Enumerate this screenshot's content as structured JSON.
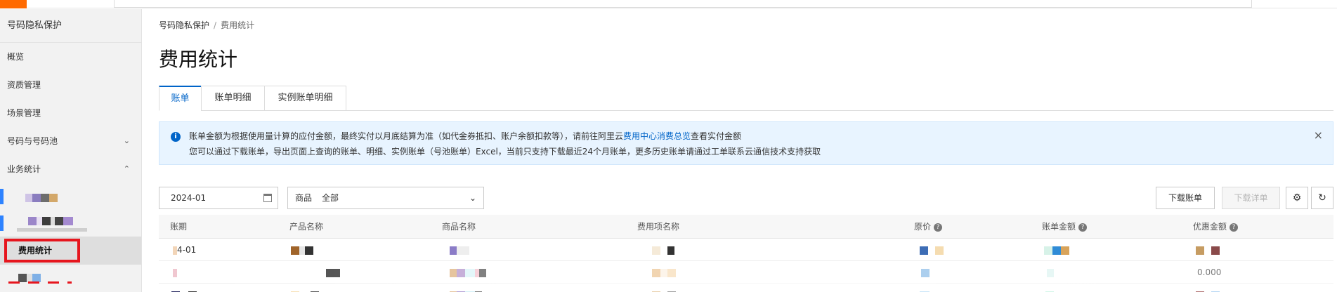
{
  "sidebar": {
    "title": "号码隐私保护",
    "items": [
      {
        "label": "概览"
      },
      {
        "label": "资质管理"
      },
      {
        "label": "场景管理"
      },
      {
        "label": "号码与号码池",
        "chevron": "chevron-down-icon"
      },
      {
        "label": "业务统计",
        "chevron": "chevron-up-icon"
      }
    ],
    "sub_active_label": "费用统计"
  },
  "breadcrumb": {
    "root": "号码隐私保护",
    "separator": "/",
    "current": "费用统计"
  },
  "page_title": "费用统计",
  "tabs": [
    {
      "label": "账单",
      "active": true
    },
    {
      "label": "账单明细",
      "active": false
    },
    {
      "label": "实例账单明细",
      "active": false
    }
  ],
  "notice": {
    "line1_pre": "账单金额为根据使用量计算的应付金额，最终实付以月底结算为准（如代金券抵扣、账户余额扣款等），请前往阿里云",
    "line1_link": "费用中心消费总览",
    "line1_post": "查看实付金额",
    "line2": "您可以通过下载账单，导出页面上查询的账单、明细、实例账单（号池账单）Excel，当前只支持下载最近24个月账单，更多历史账单请通过工单联系云通信技术支持获取",
    "close": "×"
  },
  "filters": {
    "date_value": "2024-01",
    "product_label": "商品",
    "product_value": "全部"
  },
  "actions": {
    "download_bill": "下载账单",
    "download_detail": "下载详单"
  },
  "table": {
    "columns": [
      "账期",
      "产品名称",
      "商品名称",
      "费用项名称",
      "原价",
      "账单金额",
      "优惠金额"
    ],
    "visible_cells": {
      "row1_period": "4-01",
      "row2_discount": "0.000"
    }
  },
  "colors": {
    "accent": "#0064c8",
    "highlight_box": "#e6161e",
    "notice_bg": "#e8f4ff",
    "brand_orange": "#ff6a00"
  }
}
